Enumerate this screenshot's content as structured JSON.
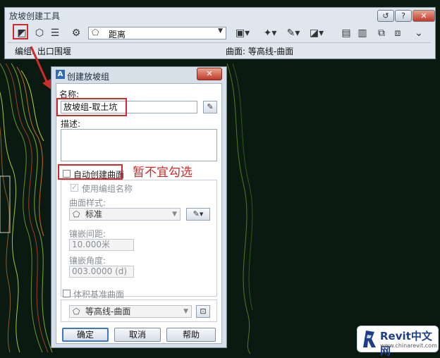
{
  "toolbar": {
    "title": "放坡创建工具",
    "help_glyph": "?",
    "close_glyph": "✕",
    "select_value": "距离",
    "status_left": "编组: 出口围堰",
    "status_right": "曲面: 等高线-曲面"
  },
  "dialog": {
    "logo_letter": "A",
    "title": "创建放坡组",
    "close_glyph": "✕",
    "name_label": "名称:",
    "name_value": "放坡组-取土坑",
    "desc_label": "描述:",
    "auto_surface_label": "自动创建曲面",
    "use_group_name_label": "使用编组名称",
    "surface_style_label": "曲面样式:",
    "surface_style_value": "标准",
    "tessellation_spacing_label": "镶嵌间距:",
    "tessellation_spacing_value": "10.000米",
    "tessellation_angle_label": "镶嵌角度:",
    "tessellation_angle_value": "003.0000 (d)",
    "volume_surface_label": "体积基准曲面",
    "volume_surface_value": "等高线-曲面",
    "ok_label": "确定",
    "cancel_label": "取消",
    "help_label": "帮助"
  },
  "annotation": "暂不宜勾选",
  "brand": {
    "name": "Revit中文网",
    "url": "www.chinarevit.com"
  },
  "colors": {
    "highlight_red": "#d12a2a",
    "ok_border": "#3a78c8",
    "brand_blue": "#1e3f87"
  }
}
